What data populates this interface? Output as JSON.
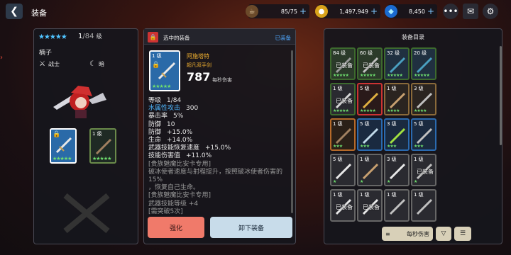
{
  "header": {
    "title": "装备",
    "back_icon": "back-icon"
  },
  "resources": [
    {
      "icon": "coffee-icon",
      "value": "85/75"
    },
    {
      "icon": "gold-coin-icon",
      "value": "1,497,949"
    },
    {
      "icon": "gem-icon",
      "value": "8,450"
    }
  ],
  "hero": {
    "level": "1",
    "max_level": "/84",
    "level_unit": "级",
    "name": "楠子",
    "role": "战士",
    "element": "暗"
  },
  "selected": {
    "panel_title": "选中的装备",
    "status": "已装备",
    "level": "1 级",
    "name": "阿施塔特",
    "rarity": "超凡双手剑",
    "dps": "787",
    "dps_label": "每秒伤害",
    "stats": [
      {
        "label": "等级",
        "value": "1/84",
        "color": "#e8e8e8"
      },
      {
        "label": "水属性攻击",
        "value": "300",
        "color": "#4fb8ff"
      },
      {
        "label": "暴击率",
        "value": "5%",
        "color": "#e8e8e8"
      },
      {
        "label": "防御",
        "value": "10",
        "color": "#e8e8e8"
      },
      {
        "label": "防御",
        "value": "+15.0%",
        "color": "#e8e8e8"
      },
      {
        "label": "生命",
        "value": "+14.0%",
        "color": "#e8e8e8"
      },
      {
        "label": "武器技能恢复速度",
        "value": "+15.0%",
        "color": "#e8e8e8"
      },
      {
        "label": "技能伤害值",
        "value": "+11.0%",
        "color": "#e8e8e8"
      }
    ],
    "notes": [
      "[贵族魅魔比安卡专用]",
      "破冰使者速度与射程提升，按照破冰使者伤害的15%",
      "，恢复自己生命。",
      "[贵族魅魔比安卡专用]",
      "武器技能等级 +4",
      "[需突破5次]"
    ],
    "enhance_label": "强化",
    "unequip_label": "卸下装备"
  },
  "catalog": {
    "title": "装备目录",
    "sort_label": "每秒伤害",
    "items": [
      {
        "lv": "84 级",
        "eq": "已装备",
        "stars": "★★★★★",
        "border": "#3d6a2e",
        "bg": "#2b3a2a",
        "col": "#9a9a9a"
      },
      {
        "lv": "60 级",
        "eq": "已装备",
        "stars": "★★★★★",
        "border": "#3d6a2e",
        "bg": "#2b3a2a",
        "col": "#bfbfbf"
      },
      {
        "lv": "32 级",
        "eq": "",
        "stars": "★★★★★",
        "border": "#3d6a2e",
        "bg": "#203040",
        "col": "#4aa0c0"
      },
      {
        "lv": "20 级",
        "eq": "",
        "stars": "★★★★★",
        "border": "#3d6a2e",
        "bg": "#203040",
        "col": "#4aa0c0"
      },
      {
        "lv": "1 级",
        "eq": "已装备",
        "stars": "★★★★★",
        "border": "#3d6a2e",
        "bg": "#2a2a30",
        "col": "#d8d8d8"
      },
      {
        "lv": "5 级",
        "eq": "",
        "stars": "★★★★★",
        "border": "#c33",
        "bg": "#2a1a1a",
        "col": "#e0b040"
      },
      {
        "lv": "1 级",
        "eq": "",
        "stars": "★★★★",
        "border": "#8a6a3a",
        "bg": "#2a2420",
        "col": "#c8a070"
      },
      {
        "lv": "3 级",
        "eq": "",
        "stars": "★★★★",
        "border": "#8a6a3a",
        "bg": "#2a2420",
        "col": "#c0c0c0"
      },
      {
        "lv": "1 级",
        "eq": "",
        "stars": "★★★",
        "border": "#b56a2a",
        "bg": "#2a2018",
        "col": "#a08060"
      },
      {
        "lv": "5 级",
        "eq": "",
        "stars": "★★★",
        "border": "#2a6ab0",
        "bg": "#1a2a40",
        "col": "#c0d8e8"
      },
      {
        "lv": "3 级",
        "eq": "",
        "stars": "★★★",
        "border": "#2a6ab0",
        "bg": "#1a2a40",
        "col": "#a0e040"
      },
      {
        "lv": "5 级",
        "eq": "",
        "stars": "★★★",
        "border": "#2a6ab0",
        "bg": "#1a2a40",
        "col": "#c0c0c0"
      },
      {
        "lv": "5 级",
        "eq": "",
        "stars": "★",
        "border": "#666",
        "bg": "#2a2a30",
        "col": "#e8e8e8"
      },
      {
        "lv": "1 级",
        "eq": "",
        "stars": "★",
        "border": "#666",
        "bg": "#2a2a30",
        "col": "#c8a070"
      },
      {
        "lv": "3 级",
        "eq": "",
        "stars": "★",
        "border": "#666",
        "bg": "#2a2a30",
        "col": "#e8e8e8"
      },
      {
        "lv": "1 级",
        "eq": "已装备",
        "stars": "★",
        "border": "#666",
        "bg": "#2a2a30",
        "col": "#c0c0c0"
      },
      {
        "lv": "1 级",
        "eq": "已装备",
        "stars": "",
        "border": "#666",
        "bg": "#2a2a30",
        "col": "#e8e8e8"
      },
      {
        "lv": "1 级",
        "eq": "已装备",
        "stars": "",
        "border": "#666",
        "bg": "#2a2a30",
        "col": "#e8e8e8"
      },
      {
        "lv": "1 级",
        "eq": "",
        "stars": "",
        "border": "#666",
        "bg": "#2a2a30",
        "col": "#c0c0c0"
      },
      {
        "lv": "1 级",
        "eq": "",
        "stars": "",
        "border": "#666",
        "bg": "#2a2a30",
        "col": "#c0c0c0"
      }
    ]
  }
}
